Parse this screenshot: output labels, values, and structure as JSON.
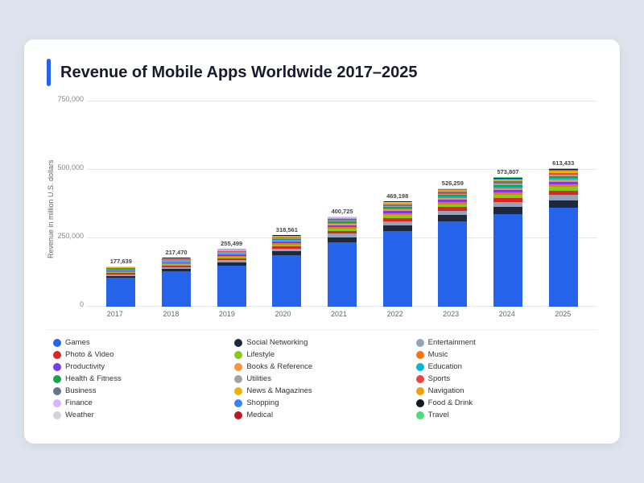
{
  "page": {
    "title": "Revenue of Mobile Apps Worldwide 2017–2025",
    "background": "#dde4ed"
  },
  "chart": {
    "yAxis": {
      "label": "Revenue in million U.S. dollars",
      "ticks": [
        "750,000",
        "500,000",
        "250,000",
        "0"
      ]
    },
    "xAxis": {
      "labels": [
        "2017",
        "2018",
        "2019",
        "2020",
        "2021",
        "2022",
        "2023",
        "2024",
        "2025"
      ]
    },
    "bars": [
      {
        "year": "2017",
        "total": "177,639",
        "height_pct": 23.7
      },
      {
        "year": "2018",
        "total": "217,470",
        "height_pct": 29.0
      },
      {
        "year": "2019",
        "total": "255,499",
        "height_pct": 34.1
      },
      {
        "year": "2020",
        "total": "318,561",
        "height_pct": 42.5
      },
      {
        "year": "2021",
        "total": "400,725",
        "height_pct": 53.4
      },
      {
        "year": "2022",
        "total": "469,198",
        "height_pct": 62.6
      },
      {
        "year": "2023",
        "total": "526,259",
        "height_pct": 70.2
      },
      {
        "year": "2024",
        "total": "573,807",
        "height_pct": 76.5
      },
      {
        "year": "2025",
        "total": "613,433",
        "height_pct": 81.8
      }
    ]
  },
  "legend": {
    "items": [
      {
        "label": "Games",
        "color": "#2563eb"
      },
      {
        "label": "Social Networking",
        "color": "#1e293b"
      },
      {
        "label": "Entertainment",
        "color": "#94a3b8"
      },
      {
        "label": "Photo & Video",
        "color": "#dc2626"
      },
      {
        "label": "Lifestyle",
        "color": "#84cc16"
      },
      {
        "label": "Music",
        "color": "#f97316"
      },
      {
        "label": "Productivity",
        "color": "#7c3aed"
      },
      {
        "label": "Books & Reference",
        "color": "#fb923c"
      },
      {
        "label": "Education",
        "color": "#06b6d4"
      },
      {
        "label": "Health & Fitness",
        "color": "#16a34a"
      },
      {
        "label": "Utilities",
        "color": "#a3a3a3"
      },
      {
        "label": "Sports",
        "color": "#ef4444"
      },
      {
        "label": "Business",
        "color": "#64748b"
      },
      {
        "label": "News & Magazines",
        "color": "#eab308"
      },
      {
        "label": "Navigation",
        "color": "#f59e0b"
      },
      {
        "label": "Finance",
        "color": "#d8b4fe"
      },
      {
        "label": "Shopping",
        "color": "#3b82f6"
      },
      {
        "label": "Food & Drink",
        "color": "#111827"
      },
      {
        "label": "Weather",
        "color": "#d1d5db"
      },
      {
        "label": "Medical",
        "color": "#b91c1c"
      },
      {
        "label": "Travel",
        "color": "#4ade80"
      }
    ]
  }
}
